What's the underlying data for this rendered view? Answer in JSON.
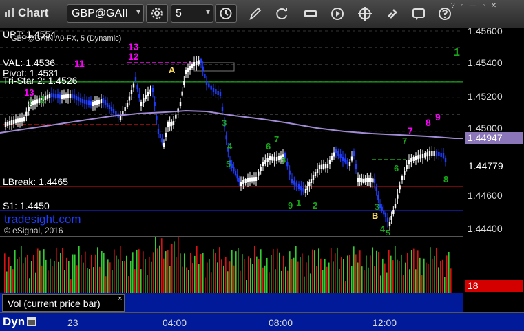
{
  "toolbar": {
    "title": "Chart",
    "symbol": "GBP@GAII",
    "interval": "5"
  },
  "chart": {
    "study_title": "GBP@GAIN A0-FX, 5 (Dynamic)",
    "watermark": "tradesight.com",
    "copyright": "© eSignal, 2016",
    "levels": {
      "upt": "UPT: 1.4554",
      "val": "VAL: 1.4536",
      "pivot": "Pivot: 1.4531",
      "tristar": "Tri-Star 2: 1.4526",
      "lbreak": "LBreak: 1.4465",
      "s1": "S1: 1.4450"
    },
    "markers": {
      "a": "A",
      "b": "B",
      "n13": "13",
      "n12": "12",
      "n11": "11",
      "n7": "7",
      "n8": "8",
      "n9": "9",
      "n1": "1"
    },
    "y_ticks": [
      "1.45600",
      "1.45400",
      "1.45200",
      "1.45000",
      "1.44800",
      "1.44600",
      "1.44400"
    ],
    "price_tag_ma": "1.44947",
    "price_tag_last": "1.44779",
    "volume_tag": "18",
    "volume_label": "Vol (current price bar)",
    "close_glyph": "×",
    "x_ticks": [
      "23",
      "04:00",
      "08:00",
      "12:00"
    ],
    "dyn_label": "Dyn"
  },
  "colors": {
    "bar": "#ffffff",
    "bar_down": "#1f3cff",
    "ma": "#a28bd6",
    "upt": "#1aa61a",
    "pivot": "#36c9c9",
    "s1": "#1f2eff",
    "lbreak": "#e01010",
    "magenta": "#ff00ff",
    "vol_up": "#33cc33",
    "vol_down": "#e01010",
    "axis_bg": "#001a99"
  }
}
